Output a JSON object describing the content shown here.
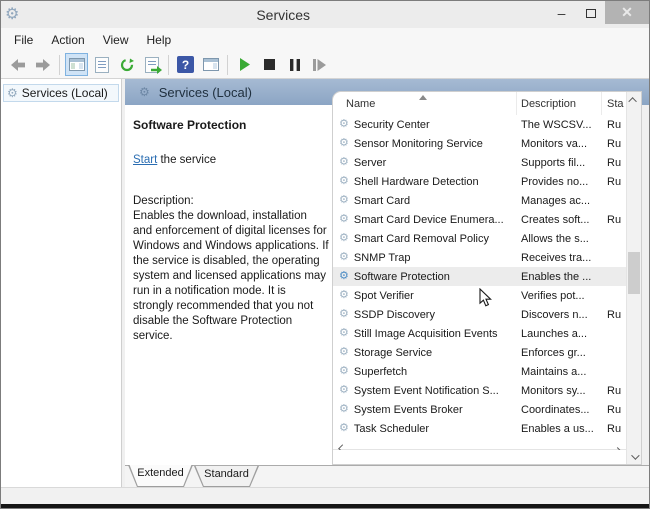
{
  "window": {
    "title": "Services",
    "minimize_glyph": "–",
    "close_glyph": "✕"
  },
  "menu": {
    "items": [
      "File",
      "Action",
      "View",
      "Help"
    ]
  },
  "toolbar": {
    "buttons": [
      "back",
      "forward",
      "show-console-tree",
      "properties",
      "refresh",
      "export-list",
      "help",
      "show-action-pane",
      "start-service",
      "stop-service",
      "pause-service",
      "restart-service"
    ]
  },
  "sidebar": {
    "root_label": "Services (Local)"
  },
  "main": {
    "header_title": "Services (Local)",
    "detail": {
      "service_name": "Software Protection",
      "start_link": "Start",
      "start_suffix": " the service",
      "description_label": "Description:",
      "description_text": "Enables the download, installation and enforcement of digital licenses for Windows and Windows applications. If the service is disabled, the operating system and licensed applications may run in a notification mode. It is strongly recommended that you not disable the Software Protection service."
    },
    "list": {
      "columns": [
        "Name",
        "Description",
        "Sta"
      ],
      "rows": [
        {
          "name": "Security Center",
          "description": "The WSCSV...",
          "status": "Ru"
        },
        {
          "name": "Sensor Monitoring Service",
          "description": "Monitors va...",
          "status": "Ru"
        },
        {
          "name": "Server",
          "description": "Supports fil...",
          "status": "Ru"
        },
        {
          "name": "Shell Hardware Detection",
          "description": "Provides no...",
          "status": "Ru"
        },
        {
          "name": "Smart Card",
          "description": "Manages ac...",
          "status": ""
        },
        {
          "name": "Smart Card Device Enumera...",
          "description": "Creates soft...",
          "status": "Ru"
        },
        {
          "name": "Smart Card Removal Policy",
          "description": "Allows the s...",
          "status": ""
        },
        {
          "name": "SNMP Trap",
          "description": "Receives tra...",
          "status": ""
        },
        {
          "name": "Software Protection",
          "description": "Enables the ...",
          "status": "",
          "selected": true
        },
        {
          "name": "Spot Verifier",
          "description": "Verifies pot...",
          "status": ""
        },
        {
          "name": "SSDP Discovery",
          "description": "Discovers n...",
          "status": "Ru"
        },
        {
          "name": "Still Image Acquisition Events",
          "description": "Launches a...",
          "status": ""
        },
        {
          "name": "Storage Service",
          "description": "Enforces gr...",
          "status": ""
        },
        {
          "name": "Superfetch",
          "description": "Maintains a...",
          "status": ""
        },
        {
          "name": "System Event Notification S...",
          "description": "Monitors sy...",
          "status": "Ru"
        },
        {
          "name": "System Events Broker",
          "description": "Coordinates...",
          "status": "Ru"
        },
        {
          "name": "Task Scheduler",
          "description": "Enables a us...",
          "status": "Ru"
        }
      ]
    }
  },
  "tabs": {
    "items": [
      "Extended",
      "Standard"
    ],
    "active": "Extended"
  },
  "colors": {
    "header_blue": "#8ba5c4",
    "link_blue": "#2a6db2",
    "start_green": "#3aaa35",
    "help_navy": "#3c57a6",
    "selection_gray": "#ececec"
  }
}
